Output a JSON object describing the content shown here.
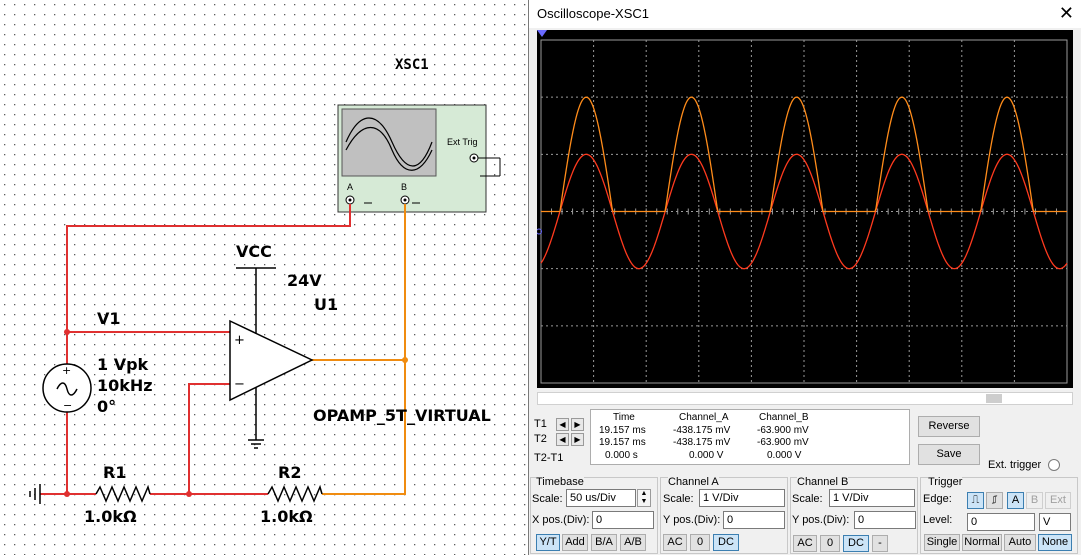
{
  "schematic": {
    "xsc_label": "XSC1",
    "ext_trig_label": "Ext Trig",
    "channel_a_pin": "A",
    "channel_b_pin": "B",
    "vcc_label": "VCC",
    "vcc_value": "24V",
    "opamp_ref": "U1",
    "opamp_model": "OPAMP_5T_VIRTUAL",
    "source_ref": "V1",
    "source_amplitude": "1 Vpk",
    "source_freq": "10kHz",
    "source_phase": "0°",
    "r1_ref": "R1",
    "r1_value": "1.0kΩ",
    "r2_ref": "R2",
    "r2_value": "1.0kΩ",
    "plus_sign": "+",
    "minus_sign": "−",
    "wire_colors": {
      "input": "#e03030",
      "output": "#f08c10"
    }
  },
  "oscilloscope": {
    "title": "Oscilloscope-XSC1",
    "close_icon": "✕",
    "screen": {
      "background": "#000000",
      "grid_color": "#9a9a9a",
      "channel_a_color": "#ff3a1e",
      "channel_b_color": "#ff8c1a",
      "cycles_visible": 5,
      "channel_a_amplitude_div": 1,
      "channel_b_amplitude_div": 2,
      "channel_b_rectified": true
    },
    "cursors": {
      "t1_label": "T1",
      "t2_label": "T2",
      "diff_label": "T2-T1",
      "headers": [
        "Time",
        "Channel_A",
        "Channel_B"
      ],
      "rows": [
        [
          "19.157 ms",
          "-438.175 mV",
          "-63.900 mV"
        ],
        [
          "19.157 ms",
          "-438.175 mV",
          "-63.900 mV"
        ],
        [
          "0.000 s",
          "0.000 V",
          "0.000 V"
        ]
      ]
    },
    "buttons": {
      "reverse": "Reverse",
      "save": "Save",
      "ext_trigger": "Ext. trigger"
    },
    "timebase": {
      "title": "Timebase",
      "scale_label": "Scale:",
      "scale_value": "50 us/Div",
      "xpos_label": "X pos.(Div):",
      "xpos_value": "0",
      "modes": [
        "Y/T",
        "Add",
        "B/A",
        "A/B"
      ]
    },
    "channel_a": {
      "title": "Channel A",
      "scale_label": "Scale:",
      "scale_value": "1 V/Div",
      "ypos_label": "Y pos.(Div):",
      "ypos_value": "0",
      "coupling": [
        "AC",
        "0",
        "DC"
      ]
    },
    "channel_b": {
      "title": "Channel B",
      "scale_label": "Scale:",
      "scale_value": "1 V/Div",
      "ypos_label": "Y pos.(Div):",
      "ypos_value": "0",
      "coupling": [
        "AC",
        "0",
        "DC",
        "-"
      ]
    },
    "trigger": {
      "title": "Trigger",
      "edge_label": "Edge:",
      "edge_sources": [
        "A",
        "B",
        "Ext"
      ],
      "level_label": "Level:",
      "level_value": "0",
      "level_unit": "V",
      "modes": [
        "Single",
        "Normal",
        "Auto",
        "None"
      ]
    }
  }
}
